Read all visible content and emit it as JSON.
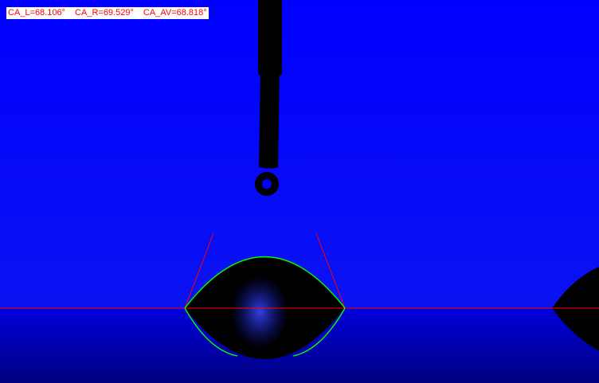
{
  "measurement": {
    "ca_left": "CA_L=68.106°",
    "ca_right": "CA_R=69.529°",
    "ca_average": "CA_AV=68.818°"
  },
  "colors": {
    "background": "#0000ff",
    "baseline": "#ff0000",
    "tangent": "#ff0000",
    "fit_curve": "#00ff00",
    "droplet": "#000000",
    "readout_text": "#ff0000",
    "readout_bg": "#ffffff"
  }
}
